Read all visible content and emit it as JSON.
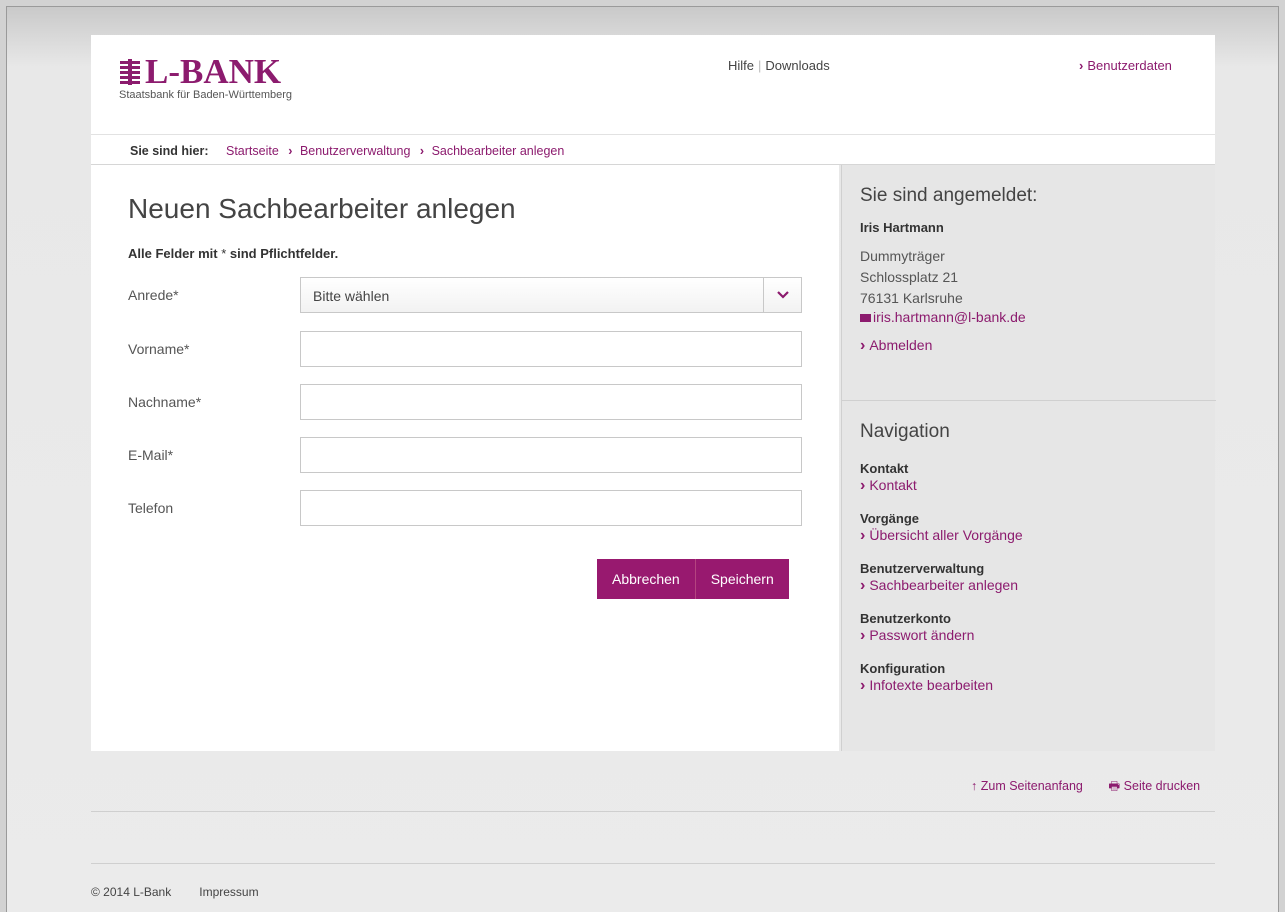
{
  "header": {
    "logo_text": "L-BANK",
    "logo_subtitle": "Staatsbank für Baden-Württemberg",
    "nav_help": "Hilfe",
    "nav_sep": "|",
    "nav_downloads": "Downloads",
    "user_data_link": "Benutzerdaten"
  },
  "breadcrumb": {
    "label": "Sie sind hier:",
    "items": [
      "Startseite",
      "Benutzerverwaltung",
      "Sachbearbeiter anlegen"
    ]
  },
  "form": {
    "title": "Neuen Sachbearbeiter anlegen",
    "required_note_bold1": "Alle Felder mit",
    "required_note_star": " * ",
    "required_note_bold2": "sind Pflichtfelder.",
    "fields": [
      {
        "label": "Anrede*",
        "value": "Bitte wählen"
      },
      {
        "label": "Vorname*",
        "value": ""
      },
      {
        "label": "Nachname*",
        "value": ""
      },
      {
        "label": "E-Mail*",
        "value": ""
      },
      {
        "label": "Telefon",
        "value": ""
      }
    ],
    "cancel_label": "Abbrechen",
    "save_label": "Speichern"
  },
  "sidebar": {
    "login_title": "Sie sind angemeldet:",
    "user_name": "Iris Hartmann",
    "org": "Dummyträger",
    "street": "Schlossplatz 21",
    "city": "76131 Karlsruhe",
    "email": "iris.hartmann@l-bank.de",
    "logout": "Abmelden",
    "nav_title": "Navigation",
    "nav_groups": [
      {
        "heading": "Kontakt",
        "link": "Kontakt"
      },
      {
        "heading": "Vorgänge",
        "link": "Übersicht aller Vorgänge"
      },
      {
        "heading": "Benutzerverwaltung",
        "link": "Sachbearbeiter anlegen"
      },
      {
        "heading": "Benutzerkonto",
        "link": "Passwort ändern"
      },
      {
        "heading": "Konfiguration",
        "link": "Infotexte bearbeiten"
      }
    ]
  },
  "footer": {
    "to_top": "Zum Seitenanfang",
    "print": "Seite drucken",
    "copyright": "© 2014 L-Bank",
    "impressum": "Impressum"
  },
  "colors": {
    "brand": "#8c1b6e",
    "button": "#98196f"
  }
}
